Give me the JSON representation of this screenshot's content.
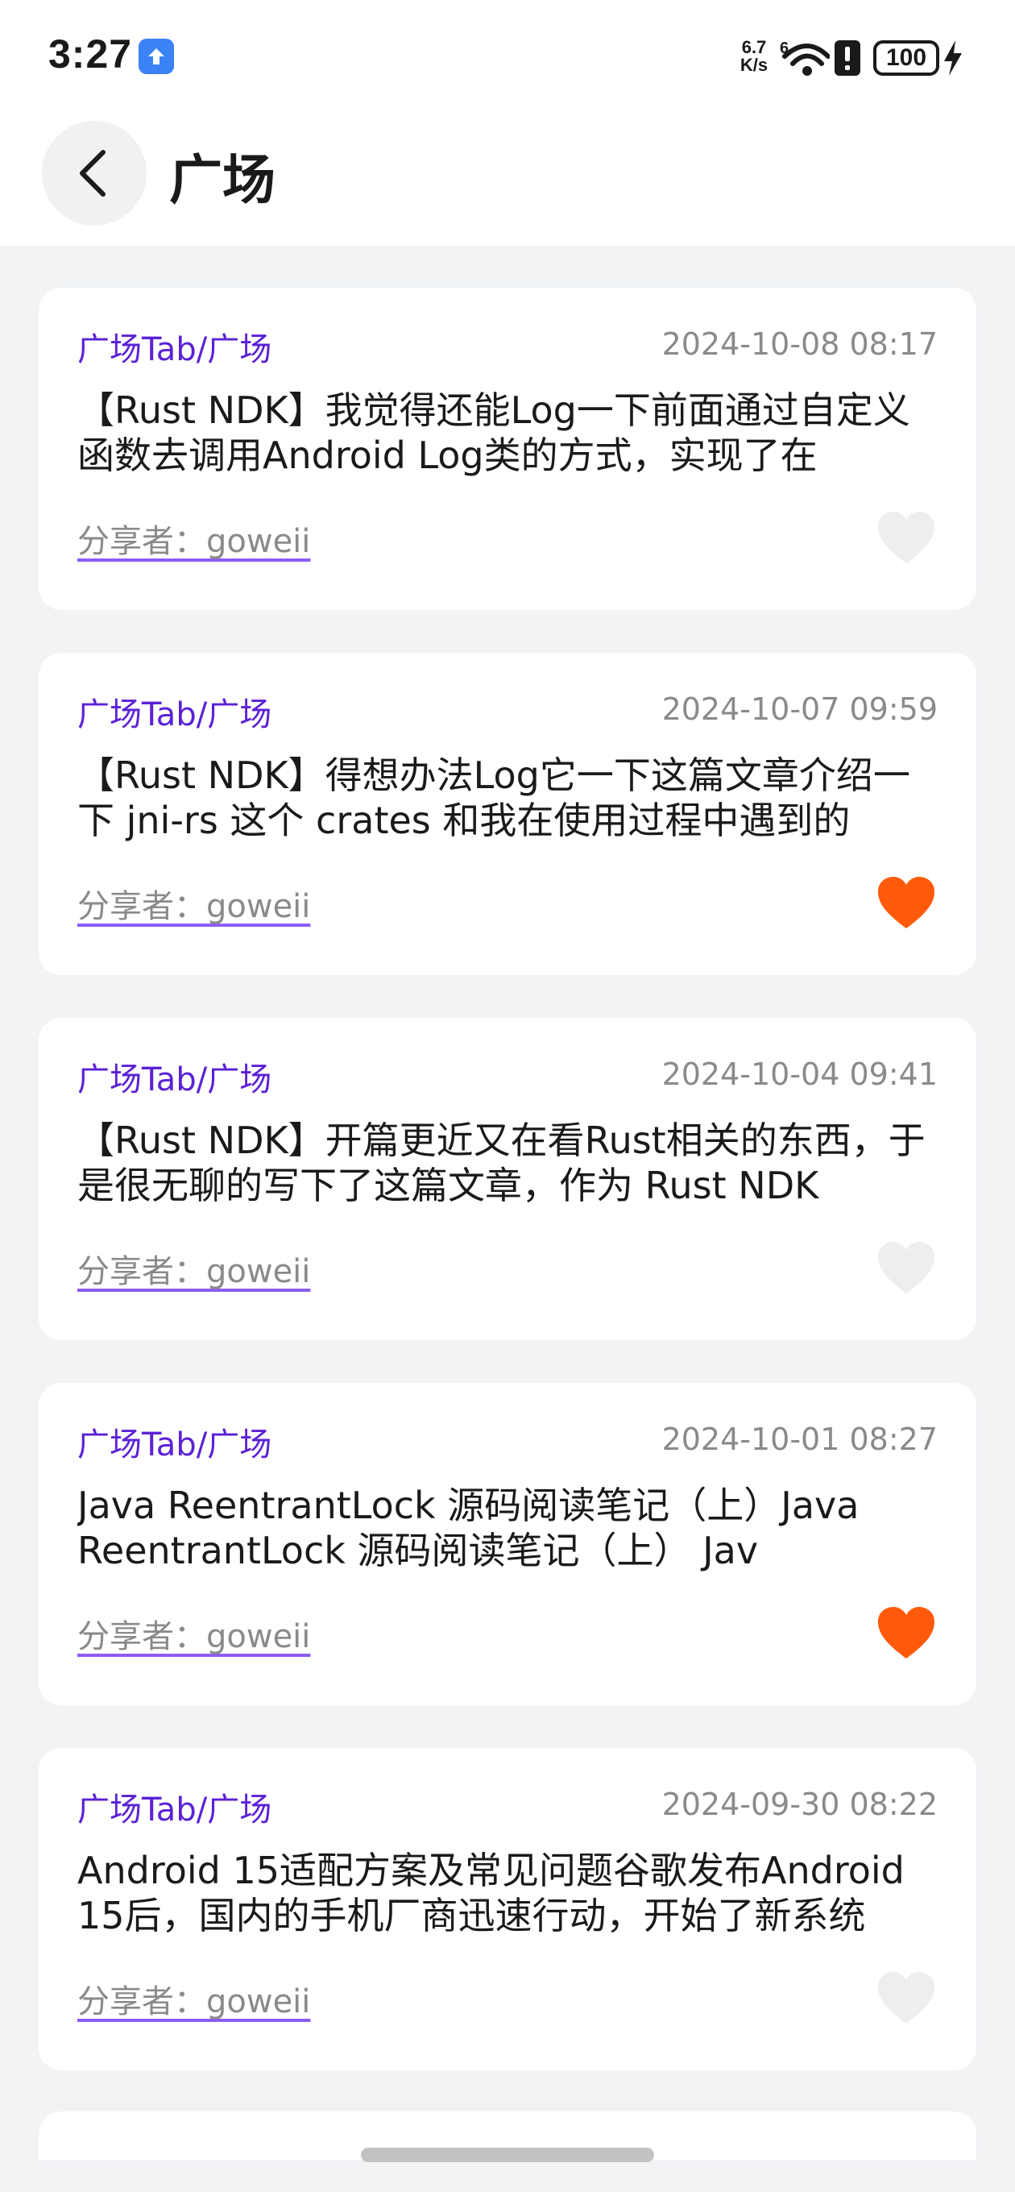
{
  "status_bar": {
    "time": "3:27",
    "net_speed_value": "6.7",
    "net_speed_unit": "K/s",
    "network_type": "6",
    "battery": "100"
  },
  "header": {
    "title": "广场",
    "back_icon": "chevron-left-icon"
  },
  "colors": {
    "accent_purple": "#5b21d6",
    "liked": "#ff5a0a",
    "unliked": "#eeeeee",
    "background": "#f1f3f5"
  },
  "articles": [
    {
      "category": "广场Tab/广场",
      "date": "2024-10-08 08:17",
      "summary": "【Rust NDK】我觉得还能Log一下前面通过自定义函数去调用Android Log类的方式，实现了在",
      "author": "分享者：goweii",
      "liked": false
    },
    {
      "category": "广场Tab/广场",
      "date": "2024-10-07 09:59",
      "summary": "【Rust NDK】得想办法Log它一下这篇文章介绍一下 jni-rs 这个 crates 和我在使用过程中遇到的",
      "author": "分享者：goweii",
      "liked": true
    },
    {
      "category": "广场Tab/广场",
      "date": "2024-10-04 09:41",
      "summary": "【Rust NDK】开篇更近又在看Rust相关的东西，于是很无聊的写下了这篇文章，作为 Rust NDK",
      "author": "分享者：goweii",
      "liked": false
    },
    {
      "category": "广场Tab/广场",
      "date": "2024-10-01 08:27",
      "summary": "Java ReentrantLock 源码阅读笔记（上）Java ReentrantLock 源码阅读笔记（上） Jav",
      "author": "分享者：goweii",
      "liked": true
    },
    {
      "category": "广场Tab/广场",
      "date": "2024-09-30 08:22",
      "summary": "Android 15适配方案及常见问题谷歌发布Android 15后，国内的手机厂商迅速行动，开始了新系统",
      "author": "分享者：goweii",
      "liked": false
    }
  ]
}
